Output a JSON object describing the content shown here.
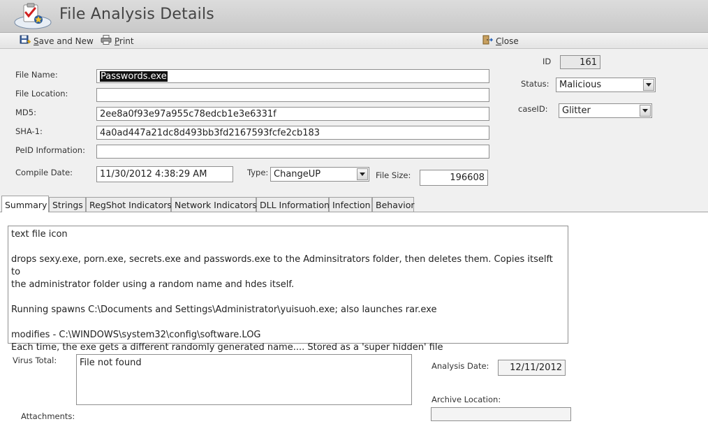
{
  "window": {
    "title": "File Analysis Details"
  },
  "toolbar": {
    "save_new": {
      "prefix": "S",
      "rest": "ave and New"
    },
    "print": {
      "prefix": "P",
      "rest": "rint"
    },
    "close": {
      "prefix": "C",
      "rest": "lose"
    }
  },
  "form": {
    "file_name": {
      "label": "File Name:",
      "value": "Passwords.exe"
    },
    "file_location": {
      "label": "File Location:",
      "value": ""
    },
    "md5": {
      "label": "MD5:",
      "value": "2ee8a0f93e97a955c78edcb1e3e6331f"
    },
    "sha1": {
      "label": "SHA-1:",
      "value": "4a0ad447a21dc8d493bb3fd2167593fcfe2cb183"
    },
    "peid": {
      "label": "PeID Information:",
      "value": ""
    },
    "compile_date": {
      "label": "Compile Date:",
      "value": "11/30/2012 4:38:29 AM"
    },
    "type": {
      "label": "Type:",
      "value": "ChangeUP"
    },
    "file_size": {
      "label": "File Size:",
      "value": "196608"
    },
    "id": {
      "label": "ID",
      "value": "161"
    },
    "status": {
      "label": "Status:",
      "value": "Malicious"
    },
    "case_id": {
      "label": "caseID:",
      "value": "Glitter"
    }
  },
  "tabs": [
    {
      "label": "Summary"
    },
    {
      "label": "Strings"
    },
    {
      "label": "RegShot Indicators"
    },
    {
      "label": "Network Indicators"
    },
    {
      "label": "DLL Information"
    },
    {
      "label": "Infection"
    },
    {
      "label": "Behavior"
    }
  ],
  "summary": {
    "lines": [
      "text file icon",
      "drops sexy.exe, porn.exe, secrets.exe and passwords.exe to the Adminsitrators folder, then deletes them.  Copies itselft to",
      "the administrator folder using a random name and hdes itself.",
      "Running spawns C:\\Documents and Settings\\Administrator\\yuisuoh.exe; also launches rar.exe",
      "modifies - C:\\WINDOWS\\system32\\config\\software.LOG",
      "Each time, the exe gets a different randomly generated name.... Stored as a 'super hidden' file"
    ],
    "virus_total": {
      "label": "Virus Total:",
      "value": "File not found"
    },
    "analysis_date": {
      "label": "Analysis Date:",
      "value": "12/11/2012"
    },
    "archive_location": {
      "label": "Archive Location:",
      "value": ""
    },
    "attachments": {
      "label": "Attachments:"
    }
  },
  "colors": {
    "title_bar": "#cfcfcf",
    "form_bg": "#f0f0f0",
    "field_border": "#8f8f8f",
    "selection": "#111111"
  }
}
